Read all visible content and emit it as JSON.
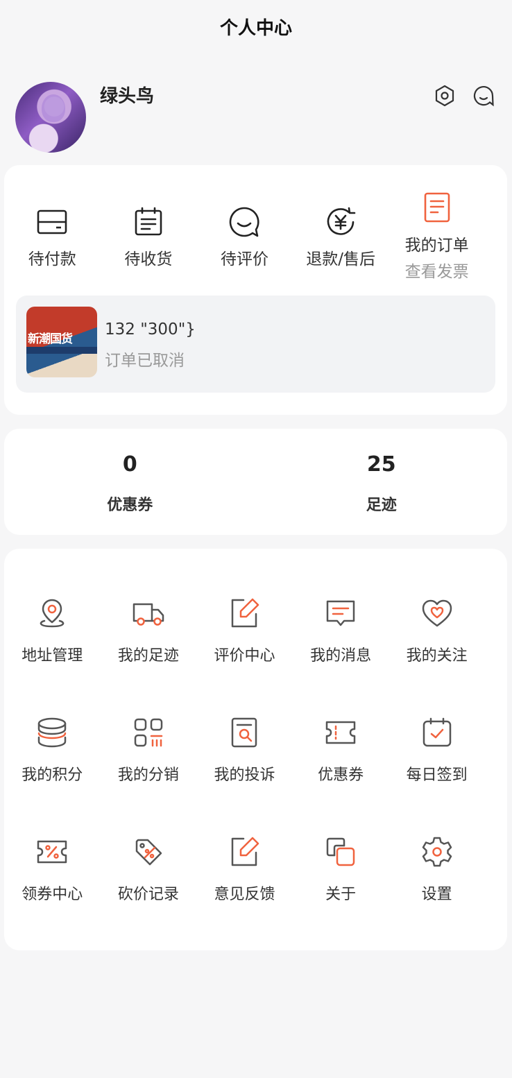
{
  "header": {
    "title": "个人中心"
  },
  "profile": {
    "username": "绿头鸟"
  },
  "orders": {
    "items": [
      {
        "label": "待付款",
        "icon": "wallet-icon"
      },
      {
        "label": "待收货",
        "icon": "calendar-icon"
      },
      {
        "label": "待评价",
        "icon": "smile-chat-icon"
      },
      {
        "label": "退款/售后",
        "icon": "refund-icon"
      }
    ],
    "all": {
      "label": "我的订单",
      "sub": "查看发票",
      "icon": "order-doc-icon"
    },
    "latest": {
      "thumb_text": "新潮国货",
      "name": "132 \"300\"}",
      "status": "订单已取消"
    }
  },
  "stats": [
    {
      "value": "0",
      "label": "优惠券"
    },
    {
      "value": "25",
      "label": "足迹"
    }
  ],
  "services": [
    {
      "label": "地址管理",
      "icon": "location-pin-icon"
    },
    {
      "label": "我的足迹",
      "icon": "truck-icon"
    },
    {
      "label": "评价中心",
      "icon": "edit-icon"
    },
    {
      "label": "我的消息",
      "icon": "message-icon"
    },
    {
      "label": "我的关注",
      "icon": "heart-chat-icon"
    },
    {
      "label": "我的积分",
      "icon": "coins-icon"
    },
    {
      "label": "我的分销",
      "icon": "grid-chart-icon"
    },
    {
      "label": "我的投诉",
      "icon": "doc-search-icon"
    },
    {
      "label": "优惠券",
      "icon": "ticket-icon"
    },
    {
      "label": "每日签到",
      "icon": "calendar-check-icon"
    },
    {
      "label": "领券中心",
      "icon": "coupon-percent-icon"
    },
    {
      "label": "砍价记录",
      "icon": "price-tag-icon"
    },
    {
      "label": "意见反馈",
      "icon": "feedback-edit-icon"
    },
    {
      "label": "关于",
      "icon": "about-squares-icon"
    },
    {
      "label": "设置",
      "icon": "gear-icon"
    }
  ],
  "colors": {
    "accent": "#f0623e",
    "dark": "#333333",
    "muted": "#999999"
  }
}
